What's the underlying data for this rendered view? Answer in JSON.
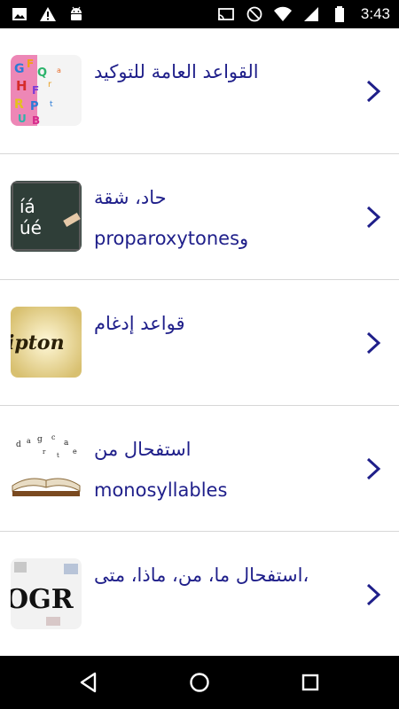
{
  "status_bar": {
    "time": "3:43",
    "icons": [
      "image-icon",
      "warning-icon",
      "android-icon",
      "cast-icon",
      "do-not-disturb-icon",
      "wifi-icon",
      "signal-icon",
      "battery-icon"
    ]
  },
  "list": {
    "items": [
      {
        "title": "القواعد العامة للتوكيد",
        "image": "colorful-letters"
      },
      {
        "title": "حاد، شقة",
        "subtitle": "وproparoxytones",
        "image": "chalkboard-accents"
      },
      {
        "title": "قواعد إدغام",
        "image": "diptongo-text"
      },
      {
        "title": "استفحال من",
        "subtitle": "monosyllables",
        "image": "open-book-letters"
      },
      {
        "title": "،استفحال ما، من، ماذا، متى",
        "image": "ogr-letters"
      }
    ]
  },
  "colors": {
    "title_text": "#1f1f8a",
    "chevron": "#1f1f8a",
    "divider": "#d7d7d7"
  }
}
